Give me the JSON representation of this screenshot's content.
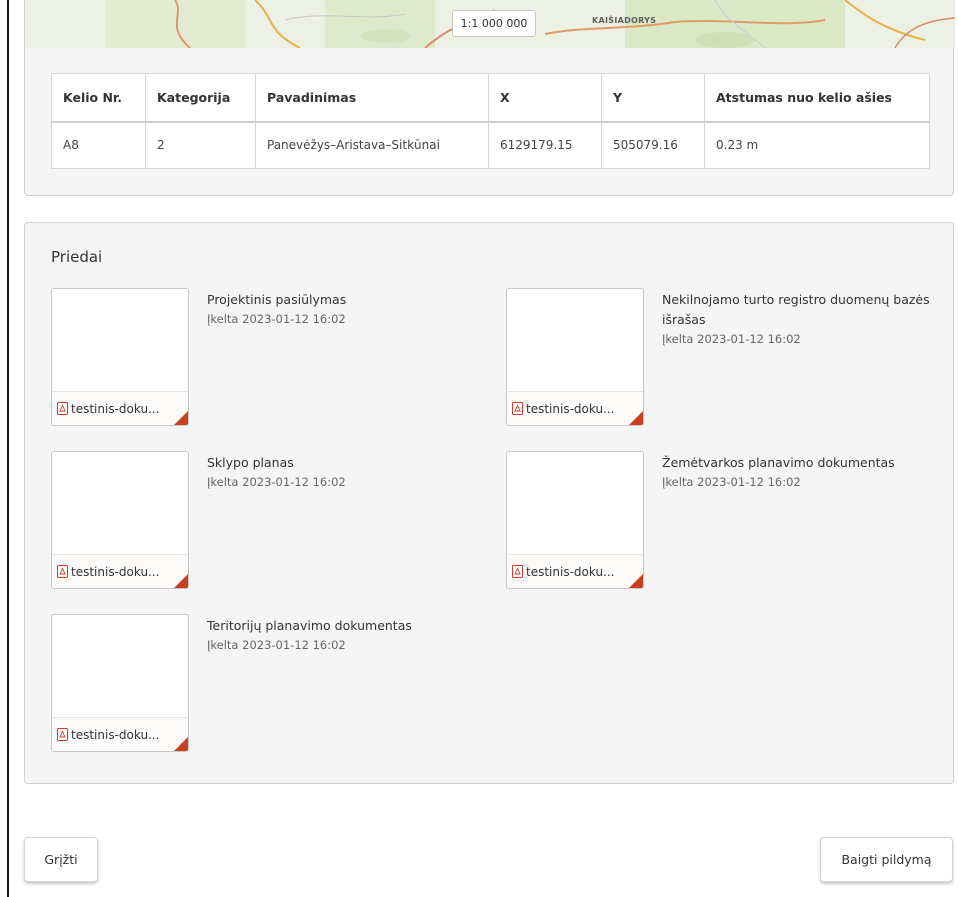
{
  "map": {
    "scale_label": "1:1 000 000",
    "city_label": "KAIŠIADORYS"
  },
  "road_table": {
    "headers": [
      "Kelio Nr.",
      "Kategorija",
      "Pavadinimas",
      "X",
      "Y",
      "Atstumas nuo kelio ašies"
    ],
    "rows": [
      [
        "A8",
        "2",
        "Panevėžys–Aristava–Sitkūnai",
        "6129179.15",
        "505079.16",
        "0.23 m"
      ]
    ]
  },
  "attachments": {
    "title": "Priedai",
    "items": [
      {
        "name": "Projektinis pasiūlymas",
        "date": "Įkelta 2023-01-12 16:02",
        "file": "testinis-doku..."
      },
      {
        "name": "Nekilnojamo turto registro duomenų bazės išrašas",
        "date": "Įkelta 2023-01-12 16:02",
        "file": "testinis-doku..."
      },
      {
        "name": "Sklypo planas",
        "date": "Įkelta 2023-01-12 16:02",
        "file": "testinis-doku..."
      },
      {
        "name": "Žemėtvarkos planavimo dokumentas",
        "date": "Įkelta 2023-01-12 16:02",
        "file": "testinis-doku..."
      },
      {
        "name": "Teritorijų planavimo dokumentas",
        "date": "Įkelta 2023-01-12 16:02",
        "file": "testinis-doku..."
      }
    ]
  },
  "buttons": {
    "back": "Grįžti",
    "finish": "Baigti pildymą"
  },
  "colors": {
    "file_corner": "#c8401f",
    "pdf_icon": "#d23a2a",
    "card_bg": "#f5f5f5"
  },
  "icons": {
    "file_type": "pdf-icon"
  }
}
